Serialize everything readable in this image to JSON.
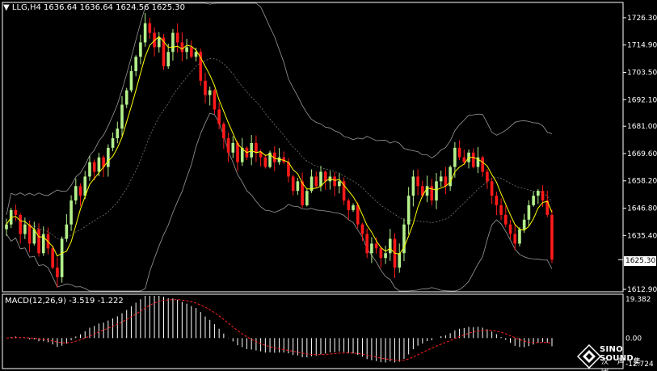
{
  "header": {
    "symbol_timeframe": "LLG,H4",
    "ohlc": "1636.64 1636.64 1624.56 1625.30"
  },
  "price_axis": {
    "ticks": [
      "1726.30",
      "1714.90",
      "1703.50",
      "1692.10",
      "1681.00",
      "1669.60",
      "1658.20",
      "1646.80",
      "1635.40",
      "1612.90"
    ],
    "current_price": "1625.30"
  },
  "macd": {
    "label": "MACD(12,26,9) -3.519 -1.222",
    "ticks": [
      "19.382",
      "0.00",
      "-12.724"
    ]
  },
  "logo": {
    "brand": "SINO SOUND",
    "sub": "汉 声 集 团"
  },
  "colors": {
    "background": "#000000",
    "up_candle": "#b4f08c",
    "down_candle": "#ff1a1a",
    "moving_average": "#ffff00",
    "bands": "#9a9a9a",
    "signal_line": "#ff2020",
    "histogram": "#ffffff"
  },
  "chart_data": {
    "type": "line",
    "title": "LLG,H4",
    "series_note": "",
    "close": [
      1640,
      1646,
      1644,
      1636,
      1640,
      1632,
      1638,
      1628,
      1636,
      1630,
      1622,
      1618,
      1634,
      1640,
      1650,
      1656,
      1652,
      1660,
      1666,
      1662,
      1668,
      1664,
      1672,
      1676,
      1680,
      1690,
      1696,
      1704,
      1710,
      1716,
      1724,
      1720,
      1714,
      1718,
      1706,
      1712,
      1720,
      1716,
      1712,
      1714,
      1710,
      1712,
      1700,
      1694,
      1696,
      1688,
      1682,
      1676,
      1670,
      1674,
      1666,
      1672,
      1668,
      1674,
      1670,
      1668,
      1664,
      1670,
      1666,
      1668,
      1666,
      1660,
      1654,
      1658,
      1648,
      1654,
      1660,
      1656,
      1662,
      1658,
      1660,
      1656,
      1658,
      1650,
      1646,
      1648,
      1640,
      1636,
      1628,
      1632,
      1630,
      1626,
      1628,
      1634,
      1622,
      1628,
      1640,
      1652,
      1660,
      1656,
      1652,
      1656,
      1650,
      1658,
      1660,
      1656,
      1664,
      1672,
      1668,
      1666,
      1670,
      1664,
      1668,
      1662,
      1658,
      1652,
      1648,
      1644,
      1640,
      1636,
      1632,
      1638,
      1642,
      1648,
      1652,
      1654,
      1650,
      1644,
      1625.3
    ],
    "ylim": [
      1612.9,
      1731
    ]
  }
}
